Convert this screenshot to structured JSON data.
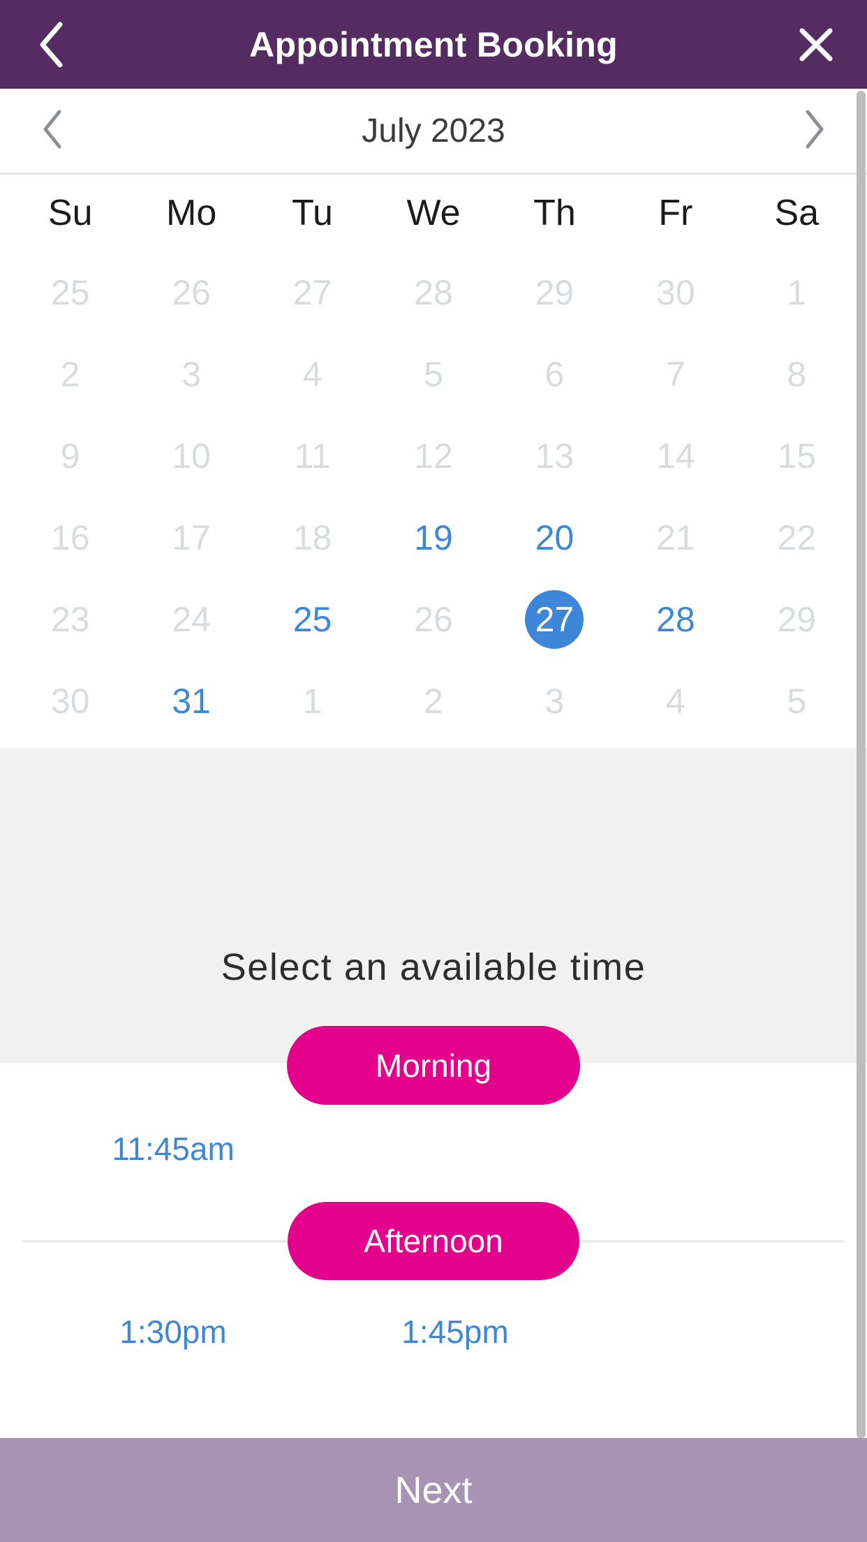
{
  "header": {
    "title": "Appointment Booking",
    "back_icon": "chevron-left-icon",
    "close_icon": "close-icon",
    "background": "#542c61"
  },
  "month_nav": {
    "prev_icon": "chevron-left-icon",
    "next_icon": "chevron-right-icon",
    "label": "July 2023"
  },
  "calendar": {
    "weekdays": [
      "Su",
      "Mo",
      "Tu",
      "We",
      "Th",
      "Fr",
      "Sa"
    ],
    "selected_day": "27",
    "available_color": "#3d86d8",
    "disabled_color": "#d8dcde",
    "weeks": [
      [
        {
          "d": "25",
          "s": "disabled"
        },
        {
          "d": "26",
          "s": "disabled"
        },
        {
          "d": "27",
          "s": "disabled"
        },
        {
          "d": "28",
          "s": "disabled"
        },
        {
          "d": "29",
          "s": "disabled"
        },
        {
          "d": "30",
          "s": "disabled"
        },
        {
          "d": "1",
          "s": "disabled"
        }
      ],
      [
        {
          "d": "2",
          "s": "disabled"
        },
        {
          "d": "3",
          "s": "disabled"
        },
        {
          "d": "4",
          "s": "disabled"
        },
        {
          "d": "5",
          "s": "disabled"
        },
        {
          "d": "6",
          "s": "disabled"
        },
        {
          "d": "7",
          "s": "disabled"
        },
        {
          "d": "8",
          "s": "disabled"
        }
      ],
      [
        {
          "d": "9",
          "s": "disabled"
        },
        {
          "d": "10",
          "s": "disabled"
        },
        {
          "d": "11",
          "s": "disabled"
        },
        {
          "d": "12",
          "s": "disabled"
        },
        {
          "d": "13",
          "s": "disabled"
        },
        {
          "d": "14",
          "s": "disabled"
        },
        {
          "d": "15",
          "s": "disabled"
        }
      ],
      [
        {
          "d": "16",
          "s": "disabled"
        },
        {
          "d": "17",
          "s": "disabled"
        },
        {
          "d": "18",
          "s": "disabled"
        },
        {
          "d": "19",
          "s": "available"
        },
        {
          "d": "20",
          "s": "available"
        },
        {
          "d": "21",
          "s": "disabled"
        },
        {
          "d": "22",
          "s": "disabled"
        }
      ],
      [
        {
          "d": "23",
          "s": "disabled"
        },
        {
          "d": "24",
          "s": "disabled"
        },
        {
          "d": "25",
          "s": "available"
        },
        {
          "d": "26",
          "s": "disabled"
        },
        {
          "d": "27",
          "s": "selected"
        },
        {
          "d": "28",
          "s": "available"
        },
        {
          "d": "29",
          "s": "disabled"
        }
      ],
      [
        {
          "d": "30",
          "s": "disabled"
        },
        {
          "d": "31",
          "s": "available"
        },
        {
          "d": "1",
          "s": "disabled"
        },
        {
          "d": "2",
          "s": "disabled"
        },
        {
          "d": "3",
          "s": "disabled"
        },
        {
          "d": "4",
          "s": "disabled"
        },
        {
          "d": "5",
          "s": "disabled"
        }
      ]
    ]
  },
  "time_section": {
    "title": "Select an available time",
    "groups": [
      {
        "label": "Morning",
        "slots": [
          "11:45am"
        ]
      },
      {
        "label": "Afternoon",
        "slots": [
          "1:30pm",
          "1:45pm"
        ]
      }
    ],
    "pill_color": "#e4018b",
    "slot_color": "#3d86d8"
  },
  "footer": {
    "next_label": "Next",
    "background": "#a794b4"
  }
}
